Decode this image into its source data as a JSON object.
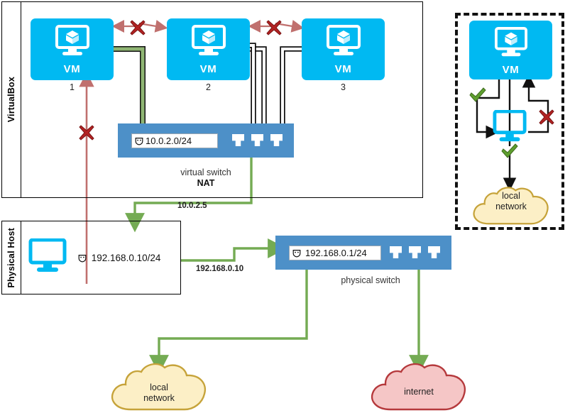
{
  "diagram": {
    "title": "VirtualBox NAT networking diagram",
    "zones": [
      {
        "id": "virtualbox",
        "label": "VirtualBox"
      },
      {
        "id": "physical-host",
        "label": "Physical Host"
      }
    ],
    "vms": [
      {
        "id": "vm1",
        "label": "VM",
        "caption": "1"
      },
      {
        "id": "vm2",
        "label": "VM",
        "caption": "2"
      },
      {
        "id": "vm3",
        "label": "VM",
        "caption": "3"
      }
    ],
    "virtual_switch": {
      "ip": "10.0.2.0/24",
      "caption_line1": "virtual switch",
      "caption_line2": "NAT",
      "ports": 3
    },
    "physical_switch": {
      "ip": "192.168.0.1/24",
      "caption": "physical switch",
      "ports": 3
    },
    "host": {
      "ip": "192.168.0.10/24"
    },
    "edge_labels": [
      {
        "id": "nat-uplink",
        "text": "10.0.2.5"
      },
      {
        "id": "host-uplink",
        "text": "192.168.0.10"
      }
    ],
    "clouds": [
      {
        "id": "local-network",
        "line1": "local",
        "line2": "network",
        "fill": "#FCEFC6",
        "stroke": "#C6A33A"
      },
      {
        "id": "internet",
        "line1": "internet",
        "line2": "",
        "fill": "#F5C6C6",
        "stroke": "#B5393C"
      }
    ],
    "detail_panel": {
      "vm": {
        "label": "VM"
      },
      "cloud": {
        "line1": "local",
        "line2": "network"
      },
      "markers": [
        {
          "id": "outbound-allowed-vm-to-host",
          "glyph": "check"
        },
        {
          "id": "inbound-blocked-host-to-vm",
          "glyph": "cross"
        },
        {
          "id": "outbound-allowed-host-to-lan",
          "glyph": "check"
        }
      ]
    },
    "blocked_links": [
      {
        "id": "vm1-vm2-blocked",
        "glyph": "cross"
      },
      {
        "id": "vm2-vm3-blocked",
        "glyph": "cross"
      },
      {
        "id": "host-to-vm1-blocked",
        "glyph": "cross"
      }
    ],
    "colors": {
      "vm_blue": "#00B9F2",
      "switch_blue": "#4D90C8",
      "allowed_green": "#74AB53",
      "blocked_red": "#B22222",
      "blocked_arrow_red": "#C0706E",
      "line_black": "#000000"
    },
    "icons": {
      "ip_badge": "shield-icon",
      "vm_glyph": "monitor-cube-icon",
      "host_glyph": "monitor-icon",
      "port_glyph": "ethernet-port-icon"
    }
  }
}
